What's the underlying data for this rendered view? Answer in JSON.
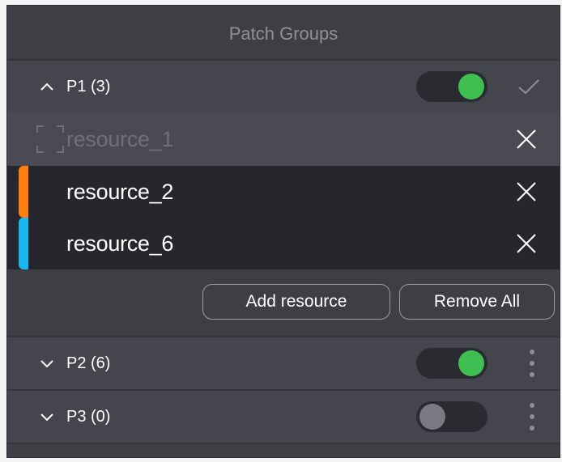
{
  "panel": {
    "title": "Patch Groups"
  },
  "groups": [
    {
      "label": "P1 (3)",
      "expanded": true,
      "enabled": true,
      "trailing_icon": "check-icon",
      "resources": [
        {
          "label": "resource_1",
          "state": "disabled",
          "icon": "frame-icon"
        },
        {
          "label": "resource_2",
          "state": "active",
          "color": "#ff7f0e"
        },
        {
          "label": "resource_6",
          "state": "active",
          "color": "#17b8f0"
        }
      ],
      "actions": {
        "add_label": "Add resource",
        "remove_all_label": "Remove All"
      }
    },
    {
      "label": "P2 (6)",
      "expanded": false,
      "enabled": true,
      "trailing_icon": "kebab-menu-icon"
    },
    {
      "label": "P3 (0)",
      "expanded": false,
      "enabled": false,
      "trailing_icon": "kebab-menu-icon"
    }
  ],
  "colors": {
    "panel_bg": "#3e3f45",
    "toggle_on": "#3fbe51",
    "toggle_off": "#7a7b82"
  }
}
